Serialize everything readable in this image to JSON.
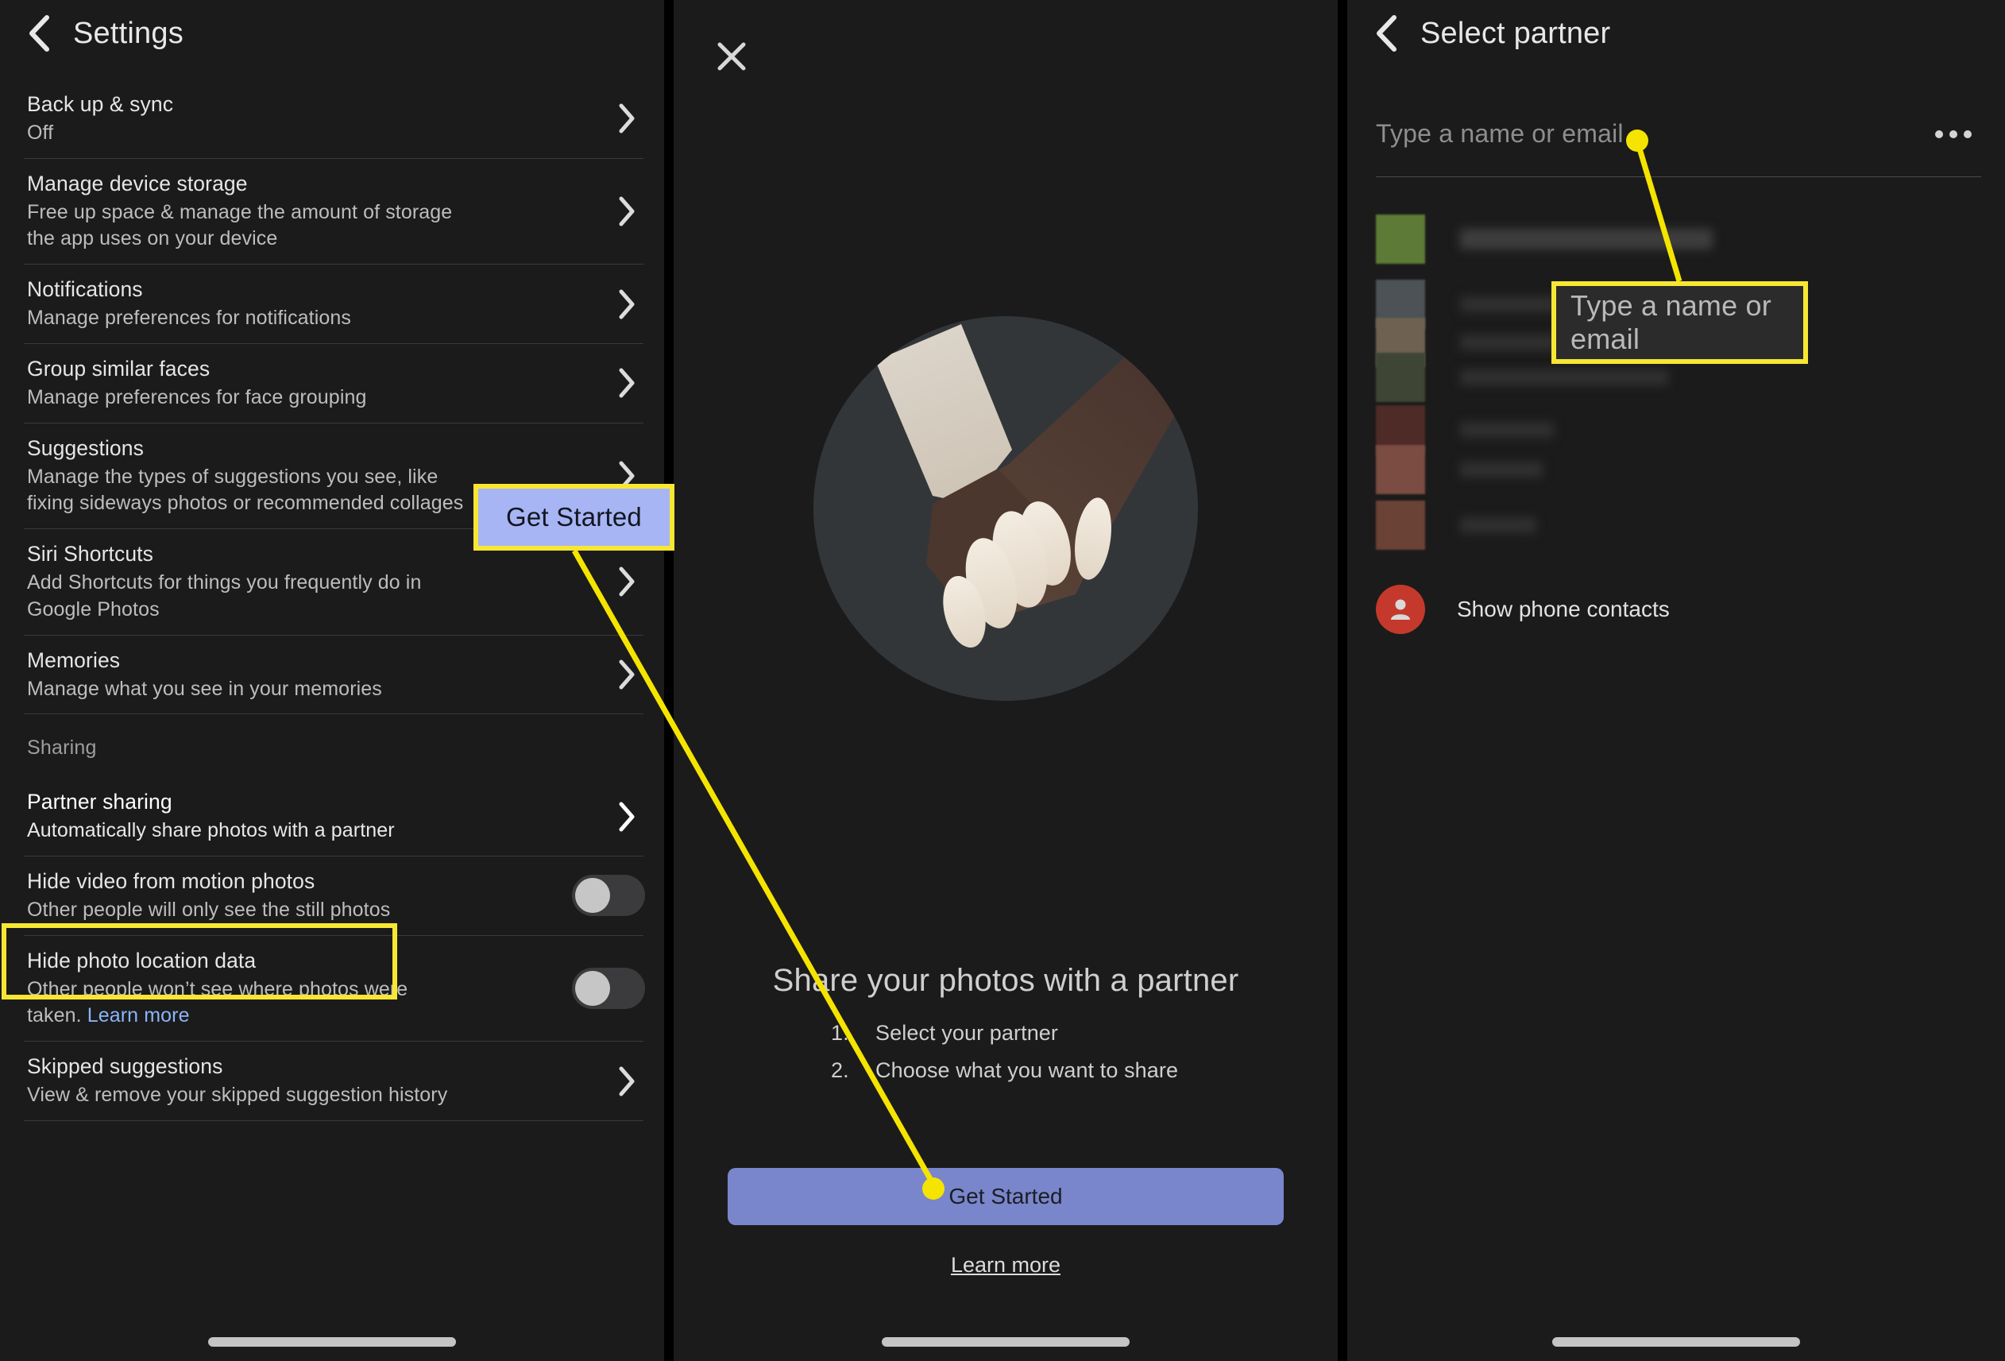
{
  "panels": {
    "settings": {
      "nav": {
        "back_icon": "chevron-left-icon",
        "title": "Settings"
      },
      "items": [
        {
          "title": "Back up & sync",
          "sub": "Off",
          "control": "chevron"
        },
        {
          "title": "Manage device storage",
          "sub": "Free up space & manage the amount of storage the app uses on your device",
          "control": "chevron"
        },
        {
          "title": "Notifications",
          "sub": "Manage preferences for notifications",
          "control": "chevron"
        },
        {
          "title": "Group similar faces",
          "sub": "Manage preferences for face grouping",
          "control": "chevron"
        },
        {
          "title": "Suggestions",
          "sub": "Manage the types of suggestions you see, like fixing sideways photos or recommended collages",
          "control": "chevron"
        },
        {
          "title": "Siri Shortcuts",
          "sub": "Add Shortcuts for things you frequently do in Google Photos",
          "control": "chevron"
        },
        {
          "title": "Memories",
          "sub": "Manage what you see in your memories",
          "control": "chevron"
        }
      ],
      "section_label": "Sharing",
      "highlighted_item": {
        "title": "Partner sharing",
        "sub": "Automatically share photos with a partner",
        "control": "chevron"
      },
      "toggle_items": [
        {
          "title": "Hide video from motion photos",
          "sub": "Other people will only see the still photos",
          "state": "off"
        },
        {
          "title": "Hide photo location data",
          "sub_prefix": "Other people won’t see where photos were taken. ",
          "sub_link": "Learn more",
          "state": "off"
        }
      ],
      "last_item": {
        "title": "Skipped suggestions",
        "sub": "View & remove your skipped suggestion history",
        "control": "chevron"
      }
    },
    "intro": {
      "close_icon": "close-icon",
      "illustration": "holding-hands-illustration",
      "heading": "Share your photos with a partner",
      "steps": [
        {
          "num": "1.",
          "text": "Select your partner"
        },
        {
          "num": "2.",
          "text": "Choose what you want to share"
        }
      ],
      "cta_label": "Get Started",
      "learn_more_label": "Learn more"
    },
    "select_partner": {
      "nav": {
        "back_icon": "chevron-left-icon",
        "title": "Select partner"
      },
      "search_placeholder": "Type a name or email",
      "overflow_icon": "kebab-menu-icon",
      "show_contacts_label": "Show phone contacts",
      "show_contacts_icon": "person-icon",
      "contact_rows_redacted": 5
    }
  },
  "annotations": {
    "callouts": [
      {
        "id": "get-started-callout",
        "label": "Get Started",
        "style": "blue-filled"
      },
      {
        "id": "type-name-callout",
        "label": "Type a name or email",
        "style": "dark-filled"
      }
    ],
    "highlight_box_target": "Partner sharing",
    "accent_color": "#f7e733",
    "callout_fill_blue": "#a7b5f5",
    "cta_button_color": "#7986cb"
  }
}
